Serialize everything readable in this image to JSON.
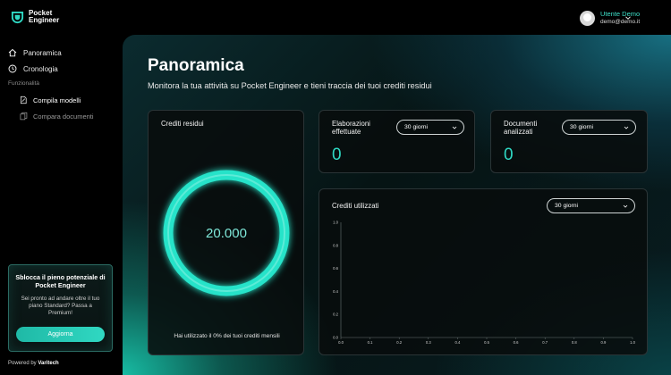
{
  "brand": {
    "line1": "Pocket",
    "line2": "Engineer",
    "footer_prefix": "Powered by",
    "footer_brand": "Varitech"
  },
  "colors": {
    "accent": "#2fd9c4",
    "user_name": "#3ee0c9"
  },
  "sidebar": {
    "items": [
      {
        "label": "Panoramica",
        "icon": "home-icon"
      },
      {
        "label": "Cronologia",
        "icon": "clock-icon"
      }
    ],
    "section_label": "Funzionalità",
    "sub_items": [
      {
        "label": "Compila modelli",
        "icon": "file-pen-icon"
      },
      {
        "label": "Compara documenti",
        "icon": "copy-docs-icon"
      }
    ]
  },
  "promo": {
    "title": "Sblocca il pieno potenziale di Pocket Engineer",
    "text": "Sei pronto ad andare oltre il tuo piano Standard? Passa a Premium!",
    "button": "Aggiorna"
  },
  "user": {
    "name": "Utente Demo",
    "email": "demo@demo.it"
  },
  "page": {
    "title": "Panoramica",
    "subtitle": "Monitora la tua attività su Pocket Engineer e tieni traccia dei tuoi crediti residui"
  },
  "cards": {
    "residui": {
      "title": "Crediti residui",
      "value": "20.000",
      "note": "Hai utilizzato il 0% dei tuoi crediti mensili",
      "used_percent": 0
    },
    "elaborazioni": {
      "title_line1": "Elaborazioni",
      "title_line2": "effettuate",
      "filter": "30 giorni",
      "value": "0"
    },
    "documenti": {
      "title_line1": "Documenti",
      "title_line2": "analizzati",
      "filter": "30 giorni",
      "value": "0"
    },
    "crediti_utilizzati": {
      "title": "Crediti utilizzati",
      "filter": "30 giorni"
    }
  },
  "chart_data": {
    "type": "line",
    "title": "Crediti utilizzati",
    "xlim": [
      0,
      1
    ],
    "ylim": [
      0,
      1
    ],
    "x_ticks": [
      "0.0",
      "0.1",
      "0.2",
      "0.3",
      "0.4",
      "0.5",
      "0.6",
      "0.7",
      "0.8",
      "0.9",
      "1.0"
    ],
    "y_ticks": [
      "0.0",
      "0.2",
      "0.4",
      "0.6",
      "0.8",
      "1.0"
    ],
    "series": [],
    "grid": true
  }
}
